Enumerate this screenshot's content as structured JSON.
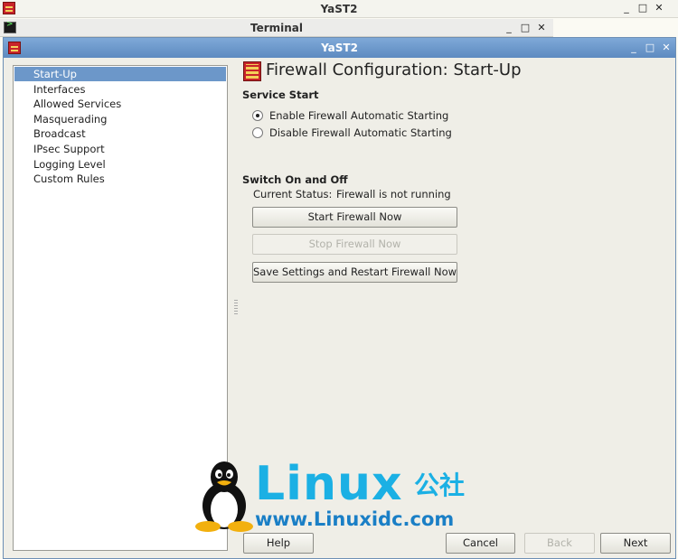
{
  "background_window": {
    "title": "YaST2",
    "minimize": "_",
    "maximize": "□",
    "close": "✕"
  },
  "terminal_window": {
    "title": "Terminal",
    "minimize": "_",
    "maximize": "□",
    "close": "✕"
  },
  "main_window": {
    "title": "YaST2",
    "minimize": "_",
    "maximize": "□",
    "close": "✕"
  },
  "sidebar": {
    "items": [
      {
        "label": "Start-Up",
        "selected": true
      },
      {
        "label": "Interfaces"
      },
      {
        "label": "Allowed Services"
      },
      {
        "label": "Masquerading"
      },
      {
        "label": "Broadcast"
      },
      {
        "label": "IPsec Support"
      },
      {
        "label": "Logging Level"
      },
      {
        "label": "Custom Rules"
      }
    ]
  },
  "content": {
    "title": "Firewall Configuration: Start-Up",
    "service_start": {
      "heading": "Service Start",
      "options": [
        {
          "label": "Enable Firewall Automatic Starting",
          "checked": true
        },
        {
          "label": "Disable Firewall Automatic Starting",
          "checked": false
        }
      ]
    },
    "switch": {
      "heading": "Switch On and Off",
      "status_label": "Current Status:",
      "status_value": "Firewall is not running",
      "start_button": "Start Firewall Now",
      "stop_button": "Stop Firewall Now",
      "save_button": "Save Settings and Restart Firewall Now"
    }
  },
  "footer": {
    "help": "Help",
    "cancel": "Cancel",
    "back": "Back",
    "next": "Next"
  },
  "watermark": {
    "brand": "Linux",
    "brand_cn": "公社",
    "url": "www.Linuxidc.com"
  },
  "colors": {
    "selection": "#6c97c9",
    "titlebar_active": "#5d8ac0",
    "watermark_cyan": "#1bb0e4"
  }
}
